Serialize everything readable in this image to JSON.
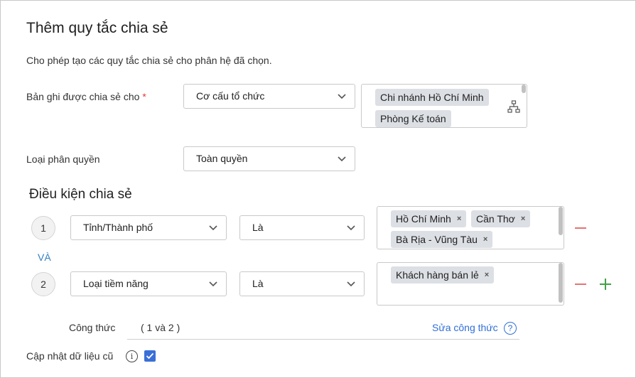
{
  "dialog": {
    "title": "Thêm quy tắc chia sẻ",
    "description": "Cho phép tạo các quy tắc chia sẻ cho phân hệ đã chọn."
  },
  "shared_records": {
    "label": "Bản ghi được chia sẻ cho",
    "required_mark": "*",
    "select_value": "Cơ cấu tổ chức",
    "tags": [
      "Chi nhánh Hồ Chí Minh",
      "Phòng Kế toán"
    ]
  },
  "permission_type": {
    "label": "Loại phân quyền",
    "select_value": "Toàn quyền"
  },
  "conditions": {
    "heading": "Điều kiện chia sẻ",
    "connector": "VÀ",
    "rows": [
      {
        "index": "1",
        "field": "Tỉnh/Thành phố",
        "operator": "Là",
        "values": [
          "Hồ Chí Minh",
          "Cần Thơ",
          "Bà Rịa - Vũng Tàu"
        ]
      },
      {
        "index": "2",
        "field": "Loại tiềm năng",
        "operator": "Là",
        "values": [
          "Khách hàng bán lẻ"
        ]
      }
    ],
    "remove_glyph": "×"
  },
  "formula": {
    "label": "Công thức",
    "value": "( 1 và 2 )",
    "edit_link": "Sửa công thức",
    "help_glyph": "?"
  },
  "update_old_data": {
    "label": "Cập nhật dữ liệu cũ",
    "info_glyph": "i",
    "checked": true
  },
  "colors": {
    "accent": "#3b6fd8",
    "link": "#2f6fd8",
    "connector": "#2f7fc1",
    "remove": "#e57373",
    "add": "#43a047",
    "tag_bg": "#dcdfe4",
    "required": "#e53935"
  }
}
